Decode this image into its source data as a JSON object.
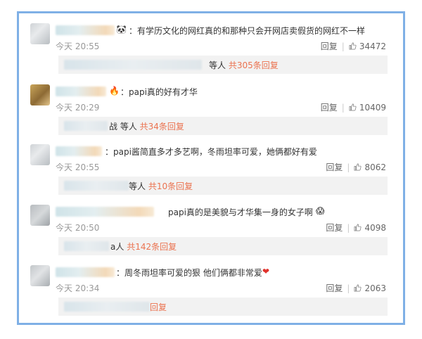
{
  "comments": [
    {
      "text": "：有学历文化的网红真的和那种只会开网店卖假货的网红不一样",
      "time": "今天 20:55",
      "reply_label": "回复",
      "likes": "34472",
      "replies_prefix": "等人",
      "replies_count": "共305条回复"
    },
    {
      "text": "：papi真的好有才华",
      "time": "今天 20:29",
      "reply_label": "回复",
      "likes": "10409",
      "replies_prefix": "战 等人",
      "replies_count": "共34条回复"
    },
    {
      "text": "：papi酱简直多才多艺啊，冬雨坦率可爱，她俩都好有爱",
      "time": "今天 20:55",
      "reply_label": "回复",
      "likes": "8062",
      "replies_prefix": "等人",
      "replies_count": "共10条回复"
    },
    {
      "text": "papi真的是美貌与才华集一身的女子啊",
      "time": "今天 20:50",
      "reply_label": "回复",
      "likes": "4098",
      "replies_prefix": "a人",
      "replies_count": "共142条回复"
    },
    {
      "text": "：周冬雨坦率可爱的狠 他们俩都非常爱",
      "time": "今天 20:34",
      "reply_label": "回复",
      "likes": "2063",
      "replies_prefix": "",
      "replies_count": "回复"
    }
  ],
  "colors": {
    "frame": "#7fb0e6",
    "link": "#eb7350",
    "meta": "#999999",
    "reply_bg": "#f2f2f2"
  }
}
